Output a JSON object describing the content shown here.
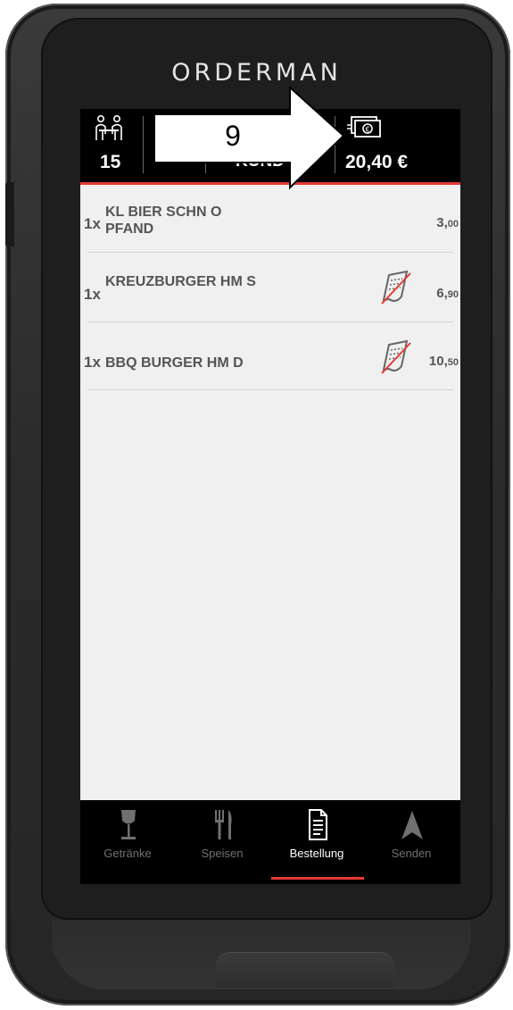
{
  "brand": "ORDERMAN",
  "header": {
    "table_number": "15",
    "total": "20,40 €",
    "hidden_label_fragment": "KUND"
  },
  "order_items": [
    {
      "qty": "1x",
      "name": "KL BIER SCHN O PFAND",
      "price_main": "3,",
      "price_cents": "00",
      "note_icon": false
    },
    {
      "qty": "1x",
      "name": "KREUZBURGER HM S",
      "price_main": "6,",
      "price_cents": "90",
      "note_icon": true
    },
    {
      "qty": "1x",
      "name": "BBQ BURGER HM D",
      "price_main": "10,",
      "price_cents": "50",
      "note_icon": true
    }
  ],
  "nav": {
    "items": [
      {
        "label": "Getränke",
        "icon": "wine-glass-icon"
      },
      {
        "label": "Speisen",
        "icon": "fork-knife-icon"
      },
      {
        "label": "Bestellung",
        "icon": "document-icon"
      },
      {
        "label": "Senden",
        "icon": "send-arrow-icon"
      }
    ],
    "active_index": 2
  },
  "callout": {
    "number": "9"
  },
  "colors": {
    "accent": "#e53935",
    "header_bg": "#000000",
    "screen_bg": "#f0f0f0"
  }
}
